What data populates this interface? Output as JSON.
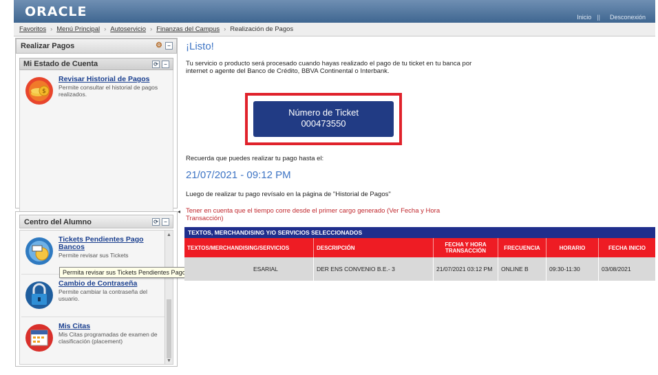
{
  "header": {
    "logo": "ORACLE",
    "links": [
      "Inicio",
      "Desconexión"
    ]
  },
  "breadcrumb": [
    "Favoritos",
    "Menú Principal",
    "Autoservicio",
    "Finanzas del Campus",
    "Realización de Pagos"
  ],
  "left": {
    "panel_title": "Realizar Pagos",
    "estado": {
      "title": "Mi Estado de Cuenta",
      "items": [
        {
          "link": "Revisar Historial de Pagos",
          "desc": "Permite consultar el historial de pagos realizados."
        }
      ]
    },
    "centro": {
      "title": "Centro del Alumno",
      "items": [
        {
          "link": "Tickets Pendientes Pago Bancos",
          "desc": "Permite revisar sus Tickets"
        },
        {
          "link": "Cambio de Contraseña",
          "desc": "Permite cambiar la contraseña del usuario."
        },
        {
          "link": "Mis Citas",
          "desc": "Mis Citas programadas de examen de clasificación (placement)"
        }
      ]
    },
    "tooltip": "Permita revisar sus Tickets Pendientes Pago en Bancos."
  },
  "main": {
    "title": "¡Listo!",
    "intro": "Tu servicio o producto será procesado cuando hayas realizado el pago de tu ticket en tu banca por internet o agente del Banco de Crédito, BBVA Continental o Interbank.",
    "ticket_label": "Número de Ticket",
    "ticket_number": "000473550",
    "recuerda": "Recuerda que puedes realizar tu pago hasta el:",
    "deadline": "21/07/2021 - 09:12 PM",
    "luego": "Luego de realizar tu pago revísalo en la página de \"Historial de Pagos\"",
    "warning": "Tener en cuenta que el tiempo corre desde el primer cargo generado (Ver Fecha y Hora Transacción)"
  },
  "table": {
    "title": "TEXTOS, MERCHANDISING Y/O SERVICIOS SELECCIONADOS",
    "headers": [
      "TEXTOS/MERCHANDISING/SERVICIOS",
      "DESCRIPCIÓN",
      "FECHA Y HORA TRANSACCIÓN",
      "FRECUENCIA",
      "HORARIO",
      "FECHA INICIO"
    ],
    "rows": [
      [
        "ESARIAL",
        "DER ENS CONVENIO B.E.- 3",
        "21/07/2021 03:12 PM",
        "ONLINE B",
        "09:30-11:30",
        "03/08/2021"
      ]
    ]
  },
  "colors": {
    "header_blue": "#3f6690",
    "ticket_button": "#213b84",
    "highlight_red": "#e0222b",
    "table_title": "#1f2e8c",
    "table_header": "#ee1c24",
    "accent_text": "#3d74c4",
    "warning_text": "#c0272d"
  }
}
